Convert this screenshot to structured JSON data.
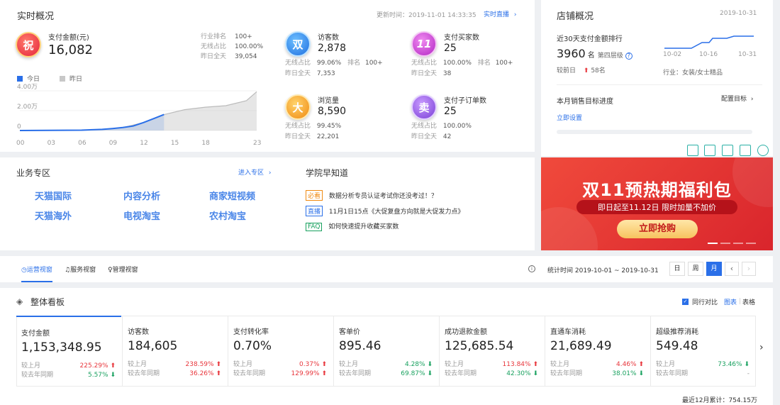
{
  "realtime": {
    "title": "实时概况",
    "update_label": "更新时间：2019-11-01 14:33:35",
    "live_link": "实时直播",
    "pay": {
      "icon_char": "祝",
      "label": "支付金额(元)",
      "value": "16,082",
      "stats": [
        {
          "k": "行业排名",
          "v": "100+"
        },
        {
          "k": "无线占比",
          "v": "100.00%"
        },
        {
          "k": "昨日全天",
          "v": "39,054"
        }
      ]
    },
    "legend_today": "今日",
    "legend_yesterday": "昨日",
    "metrics": [
      {
        "icon_char": "双",
        "label": "访客数",
        "value": "2,878",
        "ratio_label": "无线占比",
        "ratio": "99.06%",
        "rank_label": "排名",
        "rank": "100+",
        "yday_label": "昨日全天",
        "yday": "7,353"
      },
      {
        "icon_char": "11",
        "label": "支付买家数",
        "value": "25",
        "ratio_label": "无线占比",
        "ratio": "100.00%",
        "rank_label": "排名",
        "rank": "100+",
        "yday_label": "昨日全天",
        "yday": "38"
      },
      {
        "icon_char": "大",
        "label": "浏览量",
        "value": "8,590",
        "ratio_label": "无线占比",
        "ratio": "99.45%",
        "rank_label": "",
        "rank": "",
        "yday_label": "昨日全天",
        "yday": "22,201"
      },
      {
        "icon_char": "卖",
        "label": "支付子订单数",
        "value": "25",
        "ratio_label": "无线占比",
        "ratio": "100.00%",
        "rank_label": "",
        "rank": "",
        "yday_label": "昨日全天",
        "yday": "42"
      }
    ]
  },
  "chart_data": {
    "type": "area",
    "x_ticks": [
      "00",
      "03",
      "06",
      "09",
      "12",
      "15",
      "18",
      "23"
    ],
    "y_ticks": [
      "4.00万",
      "2.00万",
      "0"
    ],
    "ylim": [
      0,
      40000
    ],
    "series": [
      {
        "name": "今日",
        "x": [
          0,
          3,
          6,
          8,
          9,
          10,
          11,
          12,
          13,
          14
        ],
        "values": [
          0,
          150,
          400,
          1200,
          2000,
          3000,
          4500,
          8000,
          12000,
          16082
        ]
      },
      {
        "name": "昨日",
        "x": [
          0,
          3,
          6,
          8,
          9,
          10,
          12,
          14,
          16,
          18,
          20,
          22,
          23
        ],
        "values": [
          0,
          150,
          400,
          1200,
          2000,
          3000,
          8000,
          16000,
          21000,
          23500,
          25000,
          30000,
          39054
        ]
      }
    ]
  },
  "shop": {
    "title": "店铺概况",
    "date": "2019-10-31",
    "rank_title": "近30天支付金额排行",
    "rank_value": "3960",
    "rank_unit": "名",
    "tier": "第四层级",
    "cmp_label": "较前日",
    "cmp_value": "58名",
    "x_ticks": [
      "10-02",
      "10-16",
      "10-31"
    ],
    "industry": "行业：女装/女士精品",
    "goal_title": "本月销售目标进度",
    "goal_config": "配置目标",
    "goal_set": "立即设置"
  },
  "business": {
    "title": "业务专区",
    "enter": "进入专区",
    "links": [
      "天猫国际",
      "内容分析",
      "商家短视频",
      "天猫海外",
      "电视淘宝",
      "农村淘宝"
    ]
  },
  "academy": {
    "title": "学院早知道",
    "items": [
      {
        "tag": "必看",
        "text": "数据分析专员认证考试你还没考过！？"
      },
      {
        "tag": "直播",
        "text": "11月1日15点《大促复盘方向就是大促发力点》"
      },
      {
        "tag": "FAQ",
        "text": "如何快速提升收藏买家数"
      }
    ]
  },
  "banner": {
    "title": "双11预热期福利包",
    "subtitle": "即日起至11.12日  限时加量不加价",
    "cta": "立即抢购"
  },
  "tabs": {
    "items": [
      "运营视窗",
      "服务视窗",
      "管理视窗"
    ],
    "stat_time": "统计时间 2019-10-01 ~ 2019-10-31",
    "periods": [
      "日",
      "周",
      "月"
    ]
  },
  "board": {
    "title": "整体看板",
    "compare_label": "同行对比",
    "view_chart": "图表",
    "view_table": "表格",
    "footer": "最近12月累计：754.15万",
    "prev_label": "较上月",
    "yoy_label": "较去年同期",
    "cells": [
      {
        "label": "支付金额",
        "value": "1,153,348.95",
        "mom": "225.29%",
        "yoy": "5.57%"
      },
      {
        "label": "访客数",
        "value": "184,605",
        "mom": "238.59%",
        "yoy": "36.26%"
      },
      {
        "label": "支付转化率",
        "value": "0.70%",
        "mom": "0.37%",
        "yoy": "129.99%"
      },
      {
        "label": "客单价",
        "value": "895.46",
        "mom": "4.28%",
        "yoy": "69.87%"
      },
      {
        "label": "成功退款金额",
        "value": "125,685.54",
        "mom": "113.84%",
        "yoy": "42.30%"
      },
      {
        "label": "直通车消耗",
        "value": "21,689.49",
        "mom": "4.46%",
        "yoy": "38.01%"
      },
      {
        "label": "超级推荐消耗",
        "value": "549.48",
        "mom": "73.46%",
        "yoy": "-"
      }
    ]
  }
}
